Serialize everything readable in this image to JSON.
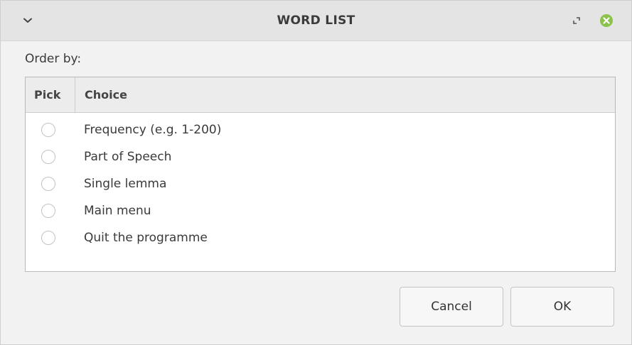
{
  "window": {
    "title": "WORD LIST",
    "close_color": "#8bc34a"
  },
  "prompt_label": "Order by:",
  "table": {
    "columns": [
      "Pick",
      "Choice"
    ],
    "rows": [
      {
        "label": "Frequency (e.g. 1-200)",
        "selected": false
      },
      {
        "label": "Part of Speech",
        "selected": false
      },
      {
        "label": "Single lemma",
        "selected": false
      },
      {
        "label": "Main menu",
        "selected": false
      },
      {
        "label": "Quit the programme",
        "selected": false
      }
    ]
  },
  "buttons": {
    "cancel_label": "Cancel",
    "ok_label": "OK"
  },
  "icons": {
    "menu": "chevron-down-icon",
    "restore": "restore-icon",
    "close": "close-icon"
  }
}
